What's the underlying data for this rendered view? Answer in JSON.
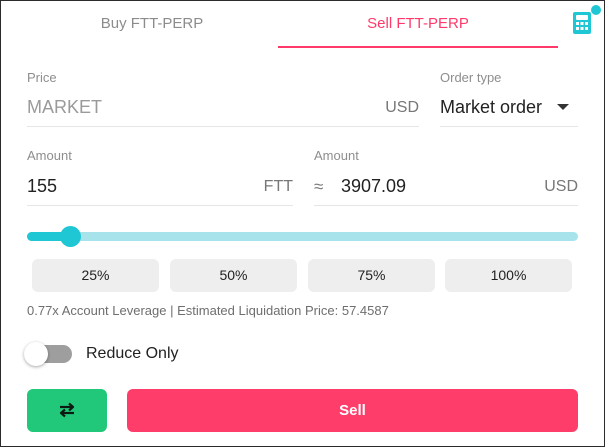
{
  "tabs": {
    "buy_label": "Buy FTT-PERP",
    "sell_label": "Sell FTT-PERP",
    "active": "sell"
  },
  "price": {
    "label": "Price",
    "value": "MARKET",
    "unit": "USD"
  },
  "order_type": {
    "label": "Order type",
    "selected": "Market order"
  },
  "amount_ftt": {
    "label": "Amount",
    "value": "155",
    "unit": "FTT"
  },
  "amount_usd": {
    "label": "Amount",
    "approx_symbol": "≈",
    "value": "3907.09",
    "unit": "USD"
  },
  "slider": {
    "fraction": 0.08
  },
  "percent_buttons": [
    "25%",
    "50%",
    "75%",
    "100%"
  ],
  "info_text": "0.77x Account Leverage | Estimated Liquidation Price: 57.4587",
  "reduce_only": {
    "label": "Reduce Only",
    "enabled": false
  },
  "actions": {
    "sell_label": "Sell"
  },
  "icons": {
    "calculator": "calculator-icon",
    "swap": "swap-arrows-icon"
  },
  "colors": {
    "sell_accent": "#ff3a6b",
    "teal": "#1fc7d4",
    "swap_green": "#21c87a"
  }
}
